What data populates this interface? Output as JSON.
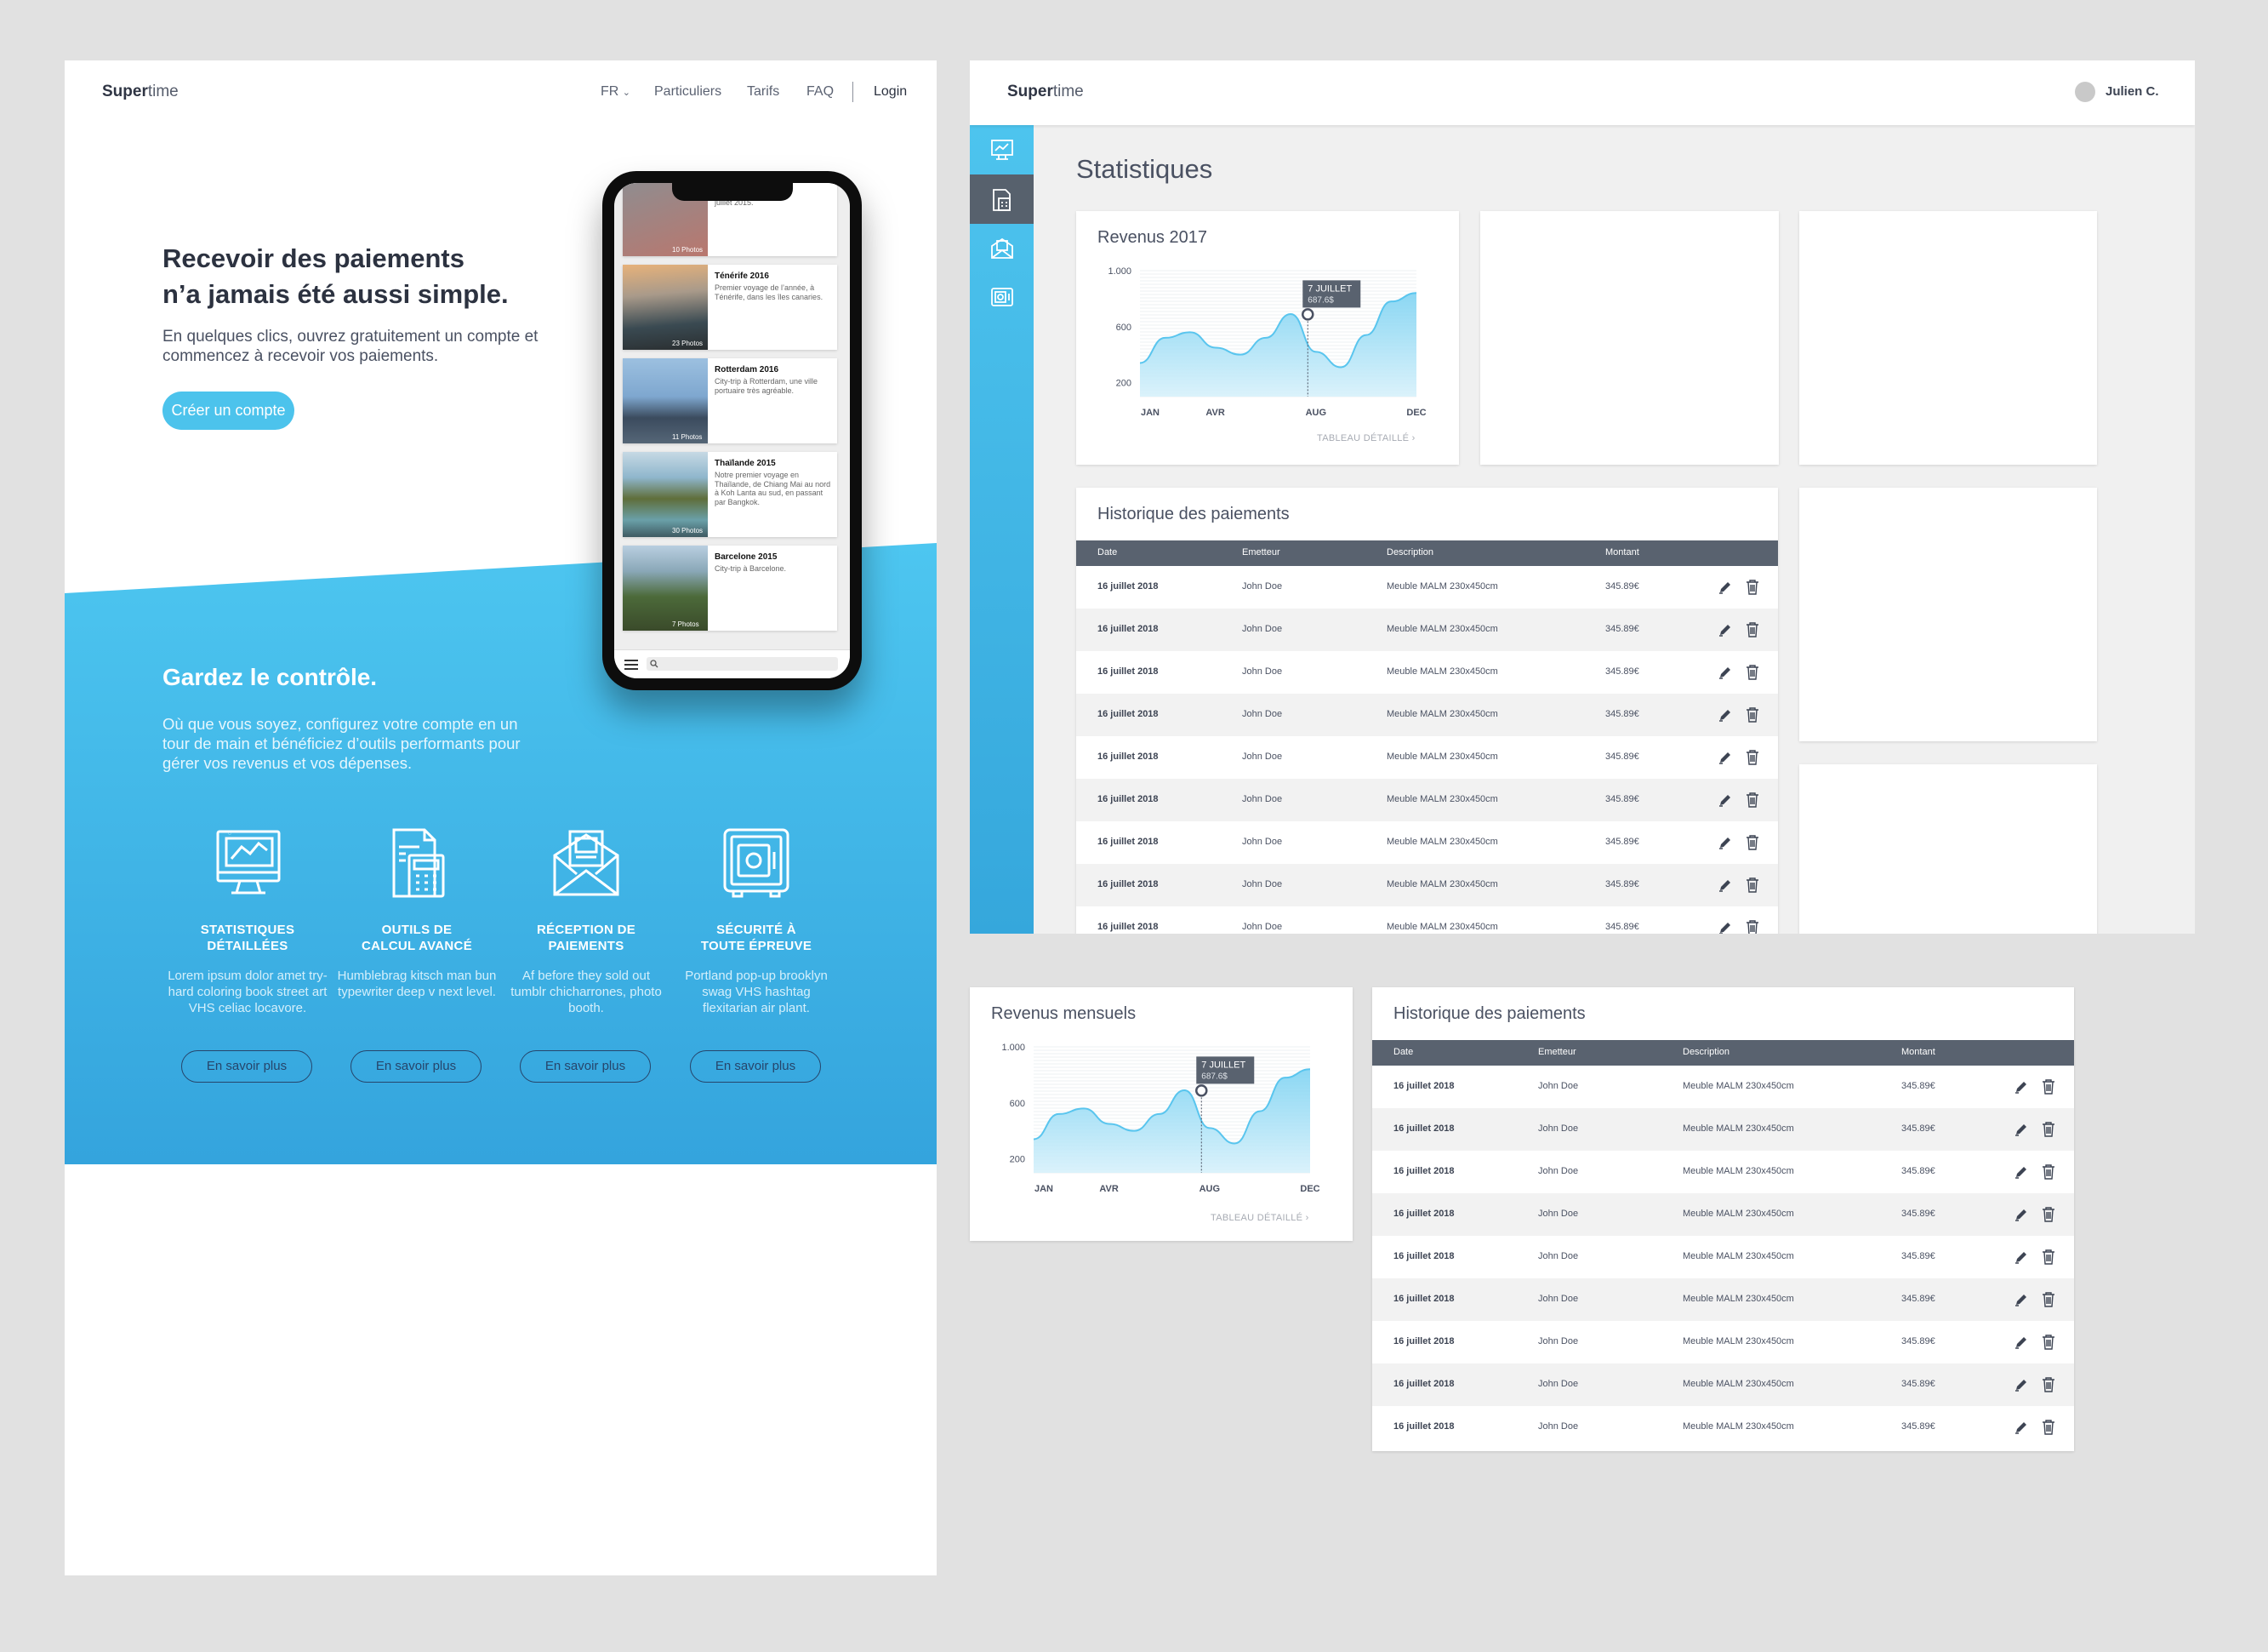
{
  "landing": {
    "logo_bold": "Super",
    "logo_light": "time",
    "nav": {
      "lang": "FR",
      "items": [
        "Particuliers",
        "Tarifs",
        "FAQ"
      ],
      "login": "Login"
    },
    "hero": {
      "title_line1": "Recevoir des paiements",
      "title_line2": "n’a jamais été aussi simple.",
      "subtitle": "En quelques clics, ouvrez gratuitement un compte et commencez à recevoir vos paiements.",
      "cta": "Créer un compte"
    },
    "control": {
      "title": "Gardez le contrôle.",
      "subtitle": "Où que vous soyez, configurez votre compte en un tour de main et bénéficiez d’outils performants pour gérer vos revenus et vos dépenses."
    },
    "features": [
      {
        "icon": "monitor-chart-icon",
        "title_1": "STATISTIQUES",
        "title_2": "DÉTAILLÉES",
        "desc": "Lorem ipsum dolor amet try-hard coloring book street art VHS celiac locavore.",
        "button": "En savoir plus"
      },
      {
        "icon": "calculator-document-icon",
        "title_1": "OUTILS DE",
        "title_2": "CALCUL AVANCÉ",
        "desc": "Humblebrag kitsch man bun typewriter deep v next level.",
        "button": "En savoir plus"
      },
      {
        "icon": "envelope-receipt-icon",
        "title_1": "RÉCEPTION DE",
        "title_2": "PAIEMENTS",
        "desc": "Af before they sold out tumblr chicharrones, photo booth.",
        "button": "En savoir plus"
      },
      {
        "icon": "safe-icon",
        "title_1": "SÉCURITÉ À",
        "title_2": "TOUTE ÉPREUVE",
        "desc": "Portland pop-up brooklyn swag VHS hashtag flexitarian air plant.",
        "button": "En savoir plus"
      }
    ],
    "phone_cards": [
      {
        "title": "",
        "desc": "juillet 2015.",
        "count": "10 Photos",
        "color1": "#8b8f93",
        "color2": "#b9776e"
      },
      {
        "title": "Ténérife 2016",
        "desc": "Premier voyage de l’année, à Ténérife, dans les îles canaries.",
        "count": "23 Photos",
        "color1": "#d3a06a",
        "color2": "#3a4a52"
      },
      {
        "title": "Rotterdam 2016",
        "desc": "City-trip à Rotterdam, une ville portuaire très agréable.",
        "count": "11 Photos",
        "color1": "#7ea7cf",
        "color2": "#3b4b5e"
      },
      {
        "title": "Thaïlande 2015",
        "desc": "Notre premier voyage en Thaïlande, de Chiang Mai au nord à Koh Lanta au sud, en passant par Bangkok.",
        "count": "30 Photos",
        "color1": "#8fb6cc",
        "color2": "#5f6e3a"
      },
      {
        "title": "Barcelone 2015",
        "desc": "City-trip à Barcelone.",
        "count": "7 Photos",
        "color1": "#b9cee0",
        "color2": "#4c6a3a"
      }
    ]
  },
  "dashboard": {
    "logo_bold": "Super",
    "logo_light": "time",
    "user": "Julien C.",
    "page_title": "Statistiques",
    "sidebar_icons": [
      "statistics-icon",
      "calculator-icon",
      "envelope-icon",
      "safe-icon"
    ],
    "revenue_card": {
      "title": "Revenus 2017",
      "link": "TABLEAU DÉTAILLÉ ›",
      "tooltip_label": "7 JUILLET",
      "tooltip_value": "687.6$"
    },
    "history": {
      "title": "Historique des paiements",
      "columns": [
        "Date",
        "Emetteur",
        "Description",
        "Montant"
      ],
      "rows": [
        {
          "date": "16 juillet 2018",
          "sender": "John Doe",
          "desc": "Meuble MALM 230x450cm",
          "amount": "345.89€"
        },
        {
          "date": "16 juillet 2018",
          "sender": "John Doe",
          "desc": "Meuble MALM 230x450cm",
          "amount": "345.89€"
        },
        {
          "date": "16 juillet 2018",
          "sender": "John Doe",
          "desc": "Meuble MALM 230x450cm",
          "amount": "345.89€"
        },
        {
          "date": "16 juillet 2018",
          "sender": "John Doe",
          "desc": "Meuble MALM 230x450cm",
          "amount": "345.89€"
        },
        {
          "date": "16 juillet 2018",
          "sender": "John Doe",
          "desc": "Meuble MALM 230x450cm",
          "amount": "345.89€"
        },
        {
          "date": "16 juillet 2018",
          "sender": "John Doe",
          "desc": "Meuble MALM 230x450cm",
          "amount": "345.89€"
        },
        {
          "date": "16 juillet 2018",
          "sender": "John Doe",
          "desc": "Meuble MALM 230x450cm",
          "amount": "345.89€"
        },
        {
          "date": "16 juillet 2018",
          "sender": "John Doe",
          "desc": "Meuble MALM 230x450cm",
          "amount": "345.89€"
        },
        {
          "date": "16 juillet 2018",
          "sender": "John Doe",
          "desc": "Meuble MALM 230x450cm",
          "amount": "345.89€"
        }
      ]
    }
  },
  "monthly_card": {
    "title": "Revenus mensuels",
    "link": "TABLEAU DÉTAILLÉ ›",
    "tooltip_label": "7 JUILLET",
    "tooltip_value": "687.6$"
  },
  "history_card": {
    "title": "Historique des paiements"
  },
  "colors": {
    "accent": "#4cc3ec",
    "dark": "#59626f",
    "text": "#3d4453",
    "background": "#e1e1e1"
  },
  "chart_data": [
    {
      "type": "area",
      "title": "Revenus 2017",
      "xlabel": "",
      "ylabel": "",
      "x_tick_labels": [
        "JAN",
        "AVR",
        "AUG",
        "DEC"
      ],
      "y_tick_labels": [
        "1.000",
        "600",
        "200"
      ],
      "ylim": [
        100,
        1000
      ],
      "x": [
        "JAN",
        "FEB",
        "MAR",
        "APR",
        "MAY",
        "JUN",
        "JUL",
        "AUG",
        "SEP",
        "OCT",
        "NOV",
        "DEC"
      ],
      "values": [
        340,
        520,
        560,
        450,
        400,
        520,
        690,
        420,
        310,
        540,
        780,
        840
      ],
      "highlight": {
        "x": "JUL",
        "value": 687.6
      }
    },
    {
      "type": "area",
      "title": "Revenus mensuels",
      "xlabel": "",
      "ylabel": "",
      "x_tick_labels": [
        "JAN",
        "AVR",
        "AUG",
        "DEC"
      ],
      "y_tick_labels": [
        "1.000",
        "600",
        "200"
      ],
      "ylim": [
        100,
        1000
      ],
      "x": [
        "JAN",
        "FEB",
        "MAR",
        "APR",
        "MAY",
        "JUN",
        "JUL",
        "AUG",
        "SEP",
        "OCT",
        "NOV",
        "DEC"
      ],
      "values": [
        340,
        520,
        560,
        450,
        400,
        520,
        690,
        420,
        310,
        540,
        780,
        840
      ],
      "highlight": {
        "x": "JUL",
        "value": 687.6
      }
    }
  ]
}
